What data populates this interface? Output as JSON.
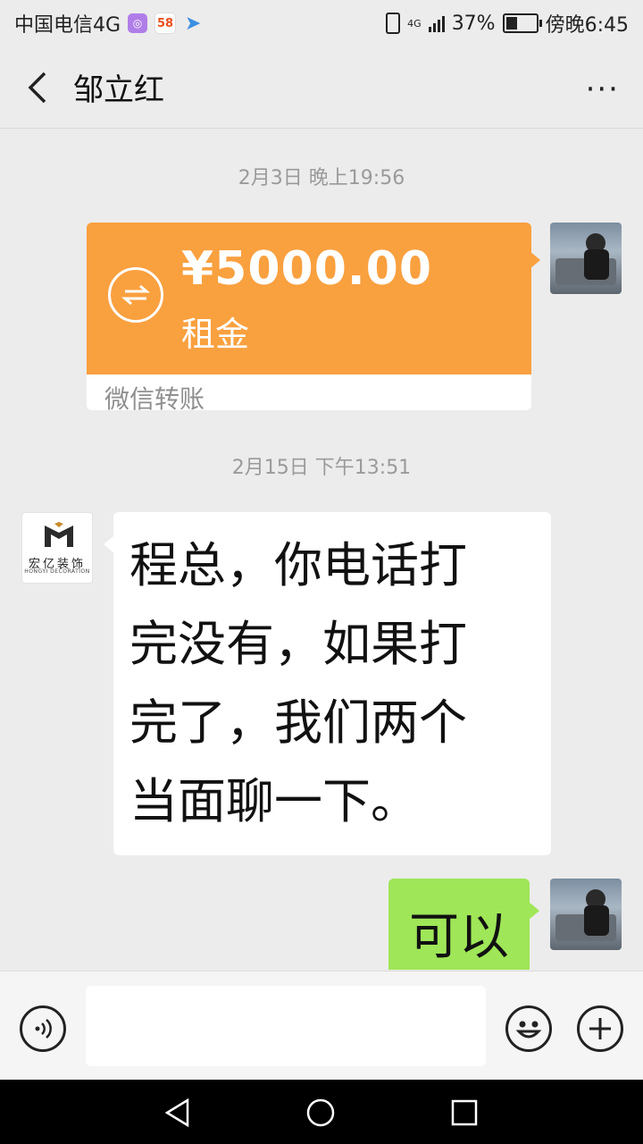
{
  "status_bar": {
    "carrier": "中国电信4G",
    "app_58": "58",
    "network": "4G",
    "battery": "37%",
    "battery_level": 0.37,
    "time": "傍晚6:45"
  },
  "header": {
    "title": "邹立红",
    "more": "···"
  },
  "chat": {
    "messages": [
      {
        "timestamp": "2月3日 晚上19:56"
      },
      {
        "type": "transfer",
        "amount": "¥5000.00",
        "note": "租金",
        "service": "微信转账"
      },
      {
        "timestamp": "2月15日 下午13:51"
      },
      {
        "type": "text_in",
        "sender_logo_cn": "宏亿装饰",
        "sender_logo_en": "HONGYI DECORATION",
        "lines": [
          "程总，你电话打",
          "完没有，如果打",
          "完了，我们两个",
          "当面聊一下。"
        ]
      },
      {
        "type": "text_out",
        "text": "可以"
      }
    ]
  },
  "colors": {
    "transfer_orange": "#f9a03f",
    "outgoing_green": "#9fe658",
    "background": "#ececec"
  }
}
